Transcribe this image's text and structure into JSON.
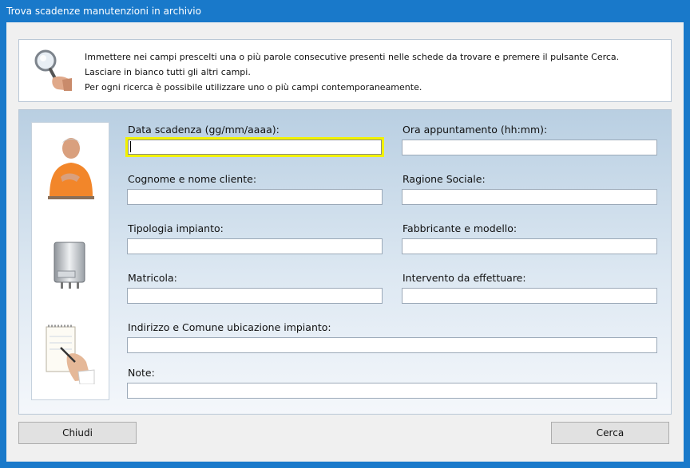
{
  "window": {
    "title": "Trova scadenze manutenzioni in archivio"
  },
  "info": {
    "lines": [
      "Immettere nei campi prescelti una o più parole consecutive presenti nelle schede da trovare e premere il pulsante Cerca.",
      "Lasciare in bianco tutti gli altri campi.",
      "Per ogni ricerca è possibile utilizzare uno o più campi contemporaneamente."
    ]
  },
  "form": {
    "data_scadenza": {
      "label": "Data scadenza (gg/mm/aaaa):",
      "value": ""
    },
    "ora_appuntamento": {
      "label": "Ora appuntamento (hh:mm):",
      "value": ""
    },
    "cognome_nome": {
      "label": "Cognome e nome cliente:",
      "value": ""
    },
    "ragione_sociale": {
      "label": "Ragione Sociale:",
      "value": ""
    },
    "tipologia": {
      "label": "Tipologia impianto:",
      "value": ""
    },
    "fabbricante": {
      "label": "Fabbricante e modello:",
      "value": ""
    },
    "matricola": {
      "label": "Matricola:",
      "value": ""
    },
    "intervento": {
      "label": "Intervento da effettuare:",
      "value": ""
    },
    "indirizzo": {
      "label": "Indirizzo e Comune ubicazione impianto:",
      "value": ""
    },
    "note": {
      "label": "Note:",
      "value": ""
    }
  },
  "buttons": {
    "close": "Chiudi",
    "search": "Cerca"
  },
  "colors": {
    "title_bar": "#1979ca",
    "focus_border": "#f2f200"
  }
}
